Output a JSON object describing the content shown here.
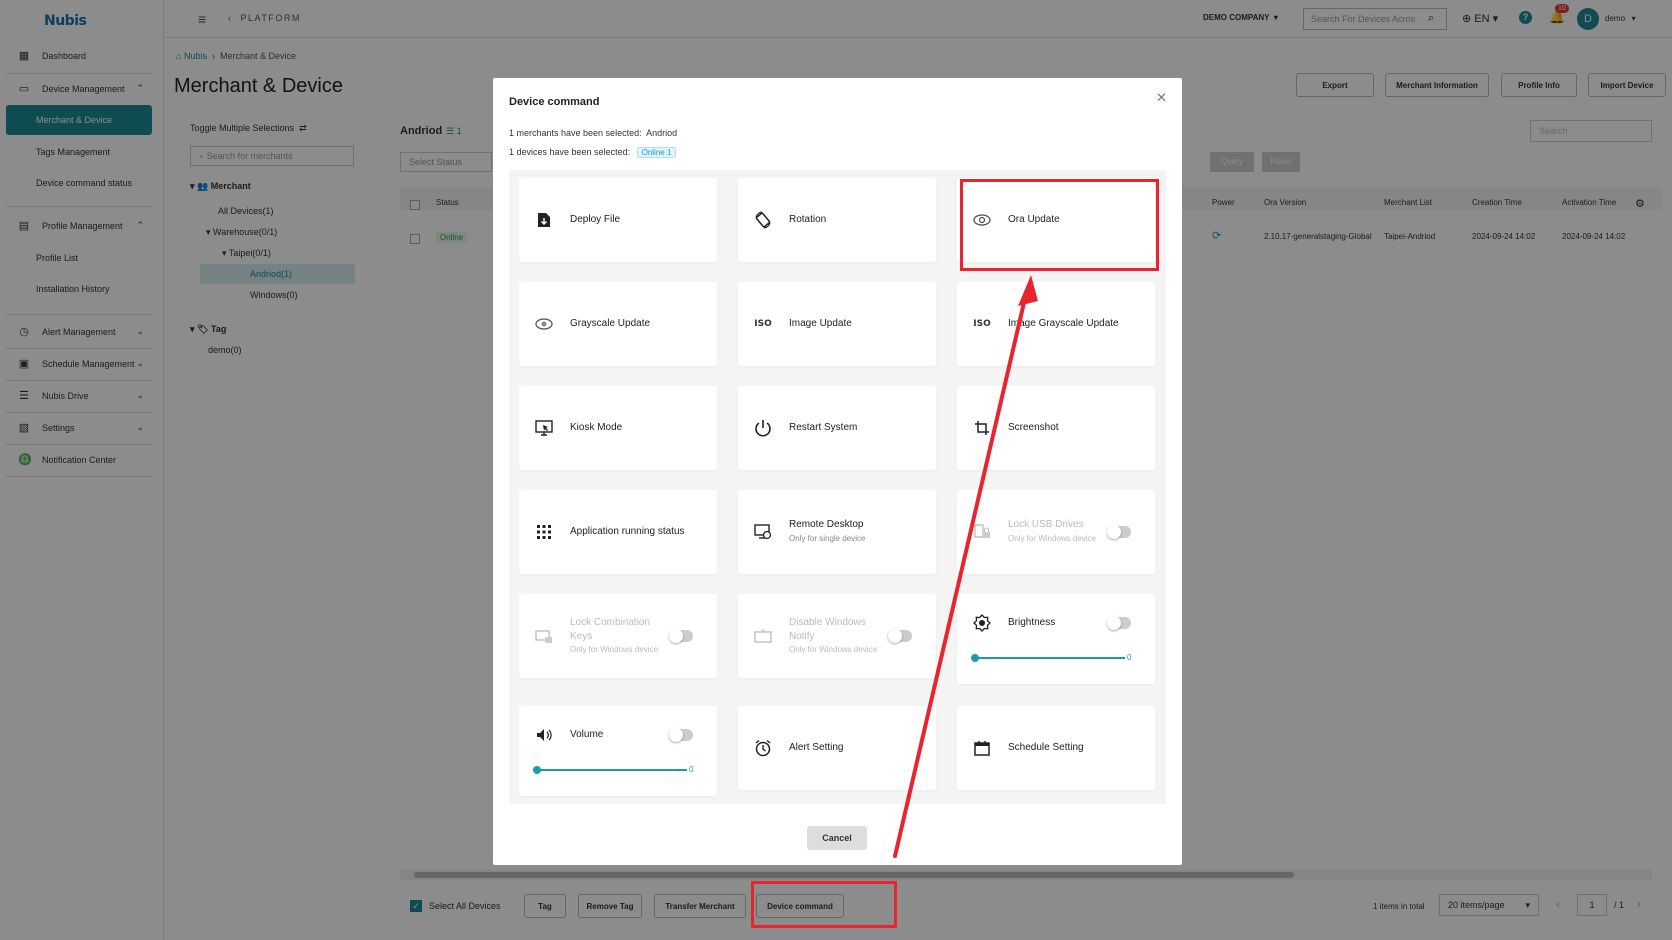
{
  "sidebar": {
    "logo_main": "Nubis",
    "items": [
      {
        "label": "Dashboard",
        "icon": "dashboard-icon"
      },
      {
        "label": "Device Management",
        "icon": "device-icon"
      },
      {
        "label": "Profile Management",
        "icon": "profile-icon"
      },
      {
        "label": "Alert Management",
        "icon": "alert-icon"
      },
      {
        "label": "Schedule Management",
        "icon": "calendar-icon"
      },
      {
        "label": "Nubis Drive",
        "icon": "drive-icon"
      },
      {
        "label": "Settings",
        "icon": "settings-icon"
      },
      {
        "label": "Notification Center",
        "icon": "notification-icon"
      }
    ],
    "sub_device": [
      "Merchant & Device",
      "Tags Management",
      "Device command status"
    ],
    "sub_profile": [
      "Profile List",
      "Installation History"
    ]
  },
  "header": {
    "platform": "PLATFORM",
    "company": "DEMO COMPANY",
    "search_placeholder": "Search For Devices Acros",
    "lang": "EN",
    "notif_count": "10",
    "avatar_letter": "D",
    "user": "demo"
  },
  "page": {
    "breadcrumb_home": "Nubis",
    "breadcrumb_current": "Merchant & Device",
    "title": "Merchant & Device",
    "actions": [
      "Export",
      "Merchant Information",
      "Profile Info",
      "Import Device"
    ],
    "toggle_label": "Toggle Multiple Selections",
    "merchant_search": "Search for merchants",
    "tree": {
      "merchant": "Merchant",
      "all": "All Devices(1)",
      "warehouse": "Warehouse(0/1)",
      "taipei": "Taipei(0/1)",
      "andriod": "Andriod(1)",
      "windows": "Windows(0)",
      "tag": "Tag",
      "demo": "demo(0)"
    },
    "list_title": "Andriod",
    "list_count": "1",
    "select_status": "Select Status",
    "search": "Search",
    "query": "Query",
    "reset": "Reset",
    "columns": [
      "Status",
      "Power",
      "Ora Version",
      "Merchant List",
      "Creation Time",
      "Activation Time"
    ],
    "row": {
      "status": "Online",
      "ora_version": "2.10.17-generalstaging-Global",
      "merchant": "Taipei-Andriod",
      "created": "2024-09-24 14:02",
      "activated": "2024-09-24 14:02"
    },
    "bottom": {
      "select_all": "Select All Devices",
      "buttons": [
        "Tag",
        "Remove Tag",
        "Transfer Merchant",
        "Device command"
      ],
      "total": "1 items in total",
      "per_page": "20 items/page",
      "page": "1",
      "pages": "/ 1"
    }
  },
  "modal": {
    "title": "Device command",
    "merchants_text": "1 merchants have been selected:",
    "merchants_value": "Andriod",
    "devices_text": "1 devices have been selected:",
    "devices_tag": "Online 1",
    "cards": {
      "deploy": "Deploy File",
      "rotation": "Rotation",
      "ora": "Ora Update",
      "grayscale": "Grayscale Update",
      "image": "Image Update",
      "image_gray": "Image Grayscale Update",
      "kiosk": "Kiosk Mode",
      "restart": "Restart System",
      "screenshot": "Screenshot",
      "apprun": "Application running status",
      "remote": "Remote Desktop",
      "remote_sub": "Only for single device",
      "lockusb": "Lock USB Drives",
      "lockusb_sub": "Only for Windows device",
      "lockcombo": "Lock Combination Keys",
      "lockcombo_sub": "Only for Windows device",
      "disnotify": "Disable Windows Notify",
      "disnotify_sub": "Only for Windows device",
      "brightness": "Brightness",
      "brightness_val": "0",
      "volume": "Volume",
      "volume_val": "0",
      "alert": "Alert Setting",
      "schedule": "Schedule Setting"
    },
    "cancel": "Cancel"
  },
  "colors": {
    "accent": "#1a8a95",
    "highlight": "#e8242f"
  }
}
